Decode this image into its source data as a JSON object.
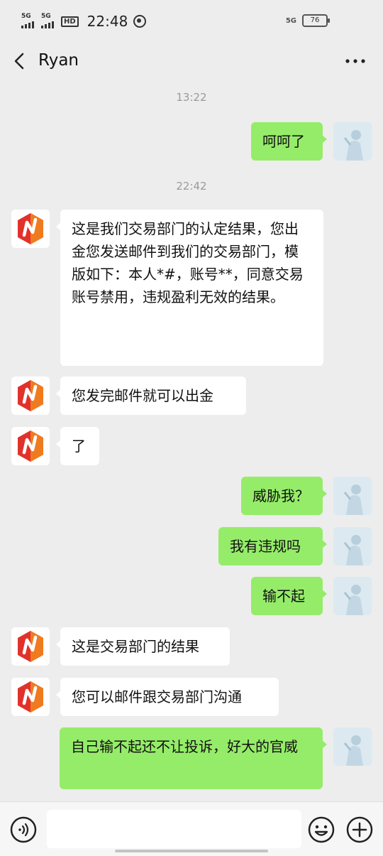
{
  "status_bar": {
    "signal_1": "5G",
    "signal_2": "5G",
    "hd": "HD",
    "time": "22:48",
    "network": "5G",
    "battery": "76"
  },
  "header": {
    "title": "Ryan",
    "back_icon": "chevron-left-icon",
    "more_icon": "more-dots-icon"
  },
  "messages": {
    "ts1": "13:22",
    "m1": "呵呵了",
    "ts2": "22:42",
    "m2": "这是我们交易部门的认定结果，您出金您发送邮件到我们的交易部门，模版如下：本人*#，账号**，同意交易账号禁用，违规盈利无效的结果。",
    "m3": "您发完邮件就可以出金",
    "m4": "了",
    "m5": "威胁我？",
    "m6": "我有违规吗",
    "m7": "输不起",
    "m8": "这是交易部门的结果",
    "m9": "您可以邮件跟交易部门沟通",
    "m10": "自己输不起还不让投诉，好大的官威"
  },
  "input_bar": {
    "voice_icon": "voice-icon",
    "placeholder": "",
    "emoji_icon": "emoji-icon",
    "plus_icon": "plus-icon"
  },
  "colors": {
    "background": "#ededed",
    "my_bubble": "#95ec69",
    "their_bubble": "#ffffff",
    "logo_red": "#e0322b",
    "logo_orange": "#f07b1e"
  }
}
